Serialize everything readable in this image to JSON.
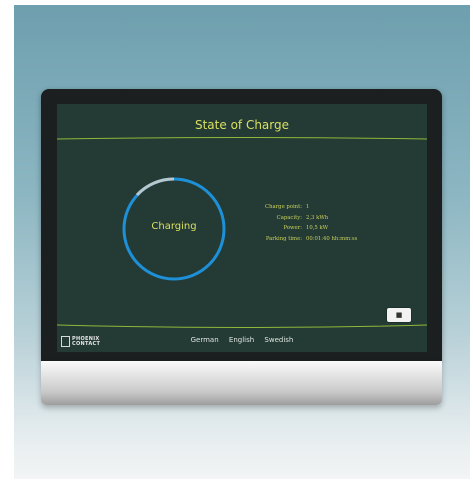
{
  "screen": {
    "title": "State of Charge",
    "ring_label": "Charging",
    "info": [
      {
        "key": "Charge point:",
        "value": "1"
      },
      {
        "key": "Capacity:",
        "value": "2,3 kWh"
      },
      {
        "key": "Power:",
        "value": "10,5 kW"
      },
      {
        "key": "Parking time:",
        "value": "00:01:40 hh:mm:ss"
      }
    ],
    "small_button_label": "■"
  },
  "footer": {
    "logo_line1": "PHOENIX",
    "logo_line2": "CONTACT",
    "languages": [
      "German",
      "English",
      "Swedish"
    ]
  },
  "colors": {
    "screen_bg": "#243a35",
    "accent_text": "#d8e060",
    "ring_blue": "#1e90d8",
    "divider_green": "#8fb83a"
  }
}
